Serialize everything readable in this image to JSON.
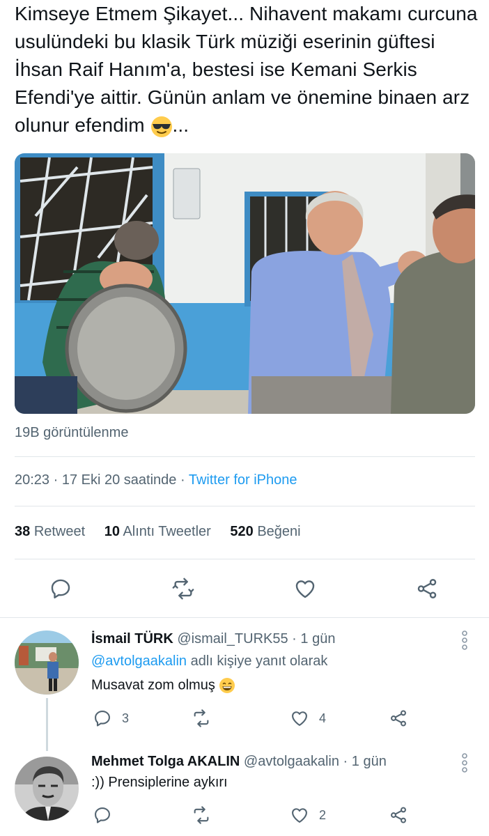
{
  "tweet": {
    "text": "Kimseye Etmem Şikayet... Nihavent makamı curcuna usulündeki bu klasik Türk müziği eserinin güftesi İhsan Raif Hanım'a, bestesi ise Kemani Serkis Efendi'ye aittir. Günün anlam ve önemine binaen arz olunur efendim",
    "text_suffix": "...",
    "emoji": "smiling-face-with-sunglasses",
    "views": "19B görüntülenme",
    "time": "20:23",
    "date_text": "17 Eki 20 saatinde",
    "separator": "·",
    "source": "Twitter for iPhone",
    "retweets_count": "38",
    "retweets_label": "Retweet",
    "quotes_count": "10",
    "quotes_label": "Alıntı Tweetler",
    "likes_count": "520",
    "likes_label": "Beğeni"
  },
  "actions": [
    "reply-icon",
    "retweet-icon",
    "like-icon",
    "share-icon"
  ],
  "replies": [
    {
      "name": "İsmail TÜRK",
      "handle": "@ismail_TURK55",
      "separator": "·",
      "time": "1 gün",
      "reply_to_mention": "@avtolgaakalin",
      "reply_to_suffix": "adlı kişiye yanıt olarak",
      "text": "Musavat zom olmuş",
      "emoji": "grinning-face-with-smiling-eyes",
      "reply_count": "3",
      "retweet_count": "",
      "like_count": "4"
    },
    {
      "name": "Mehmet Tolga AKALIN",
      "handle": "@avtolgaakalin",
      "separator": "·",
      "time": "1 gün",
      "text": ":)) Prensiplerine aykırı",
      "reply_count": "",
      "retweet_count": "",
      "like_count": "2"
    }
  ],
  "colors": {
    "text": "#0f1419",
    "secondary": "#536471",
    "link": "#1d9bf0",
    "divider": "#e1e6ea"
  }
}
